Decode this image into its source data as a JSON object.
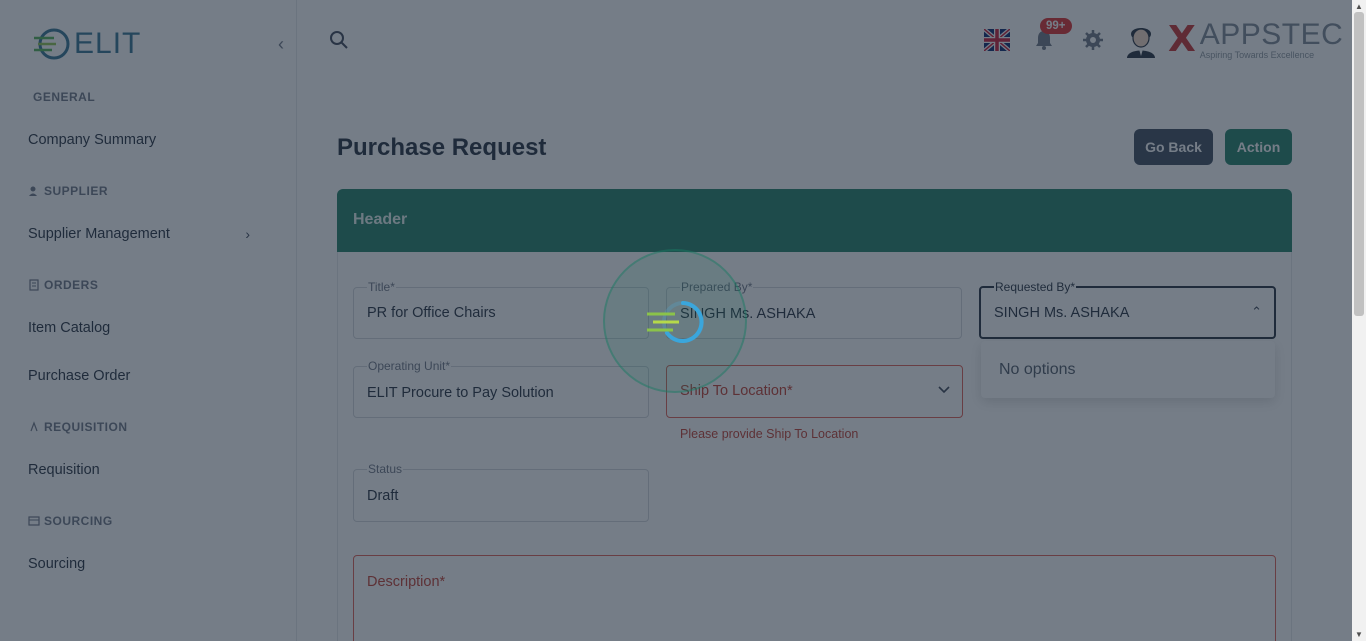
{
  "sidebar": {
    "logo_text": "ELIT",
    "sections": {
      "general": "GENERAL",
      "supplier": "SUPPLIER",
      "orders": "ORDERS",
      "requisition": "REQUISITION",
      "sourcing": "SOURCING"
    },
    "items": {
      "company_summary": "Company Summary",
      "supplier_management": "Supplier Management",
      "item_catalog": "Item Catalog",
      "purchase_order": "Purchase Order",
      "requisition": "Requisition",
      "sourcing": "Sourcing"
    }
  },
  "topbar": {
    "notification_count": "99+",
    "brand_name": "APPSTEC",
    "brand_tagline": "Aspiring Towards Excellence"
  },
  "page": {
    "title": "Purchase Request",
    "go_back_label": "Go Back",
    "action_label": "Action",
    "card_header": "Header"
  },
  "form": {
    "title": {
      "label": "Title*",
      "value": "PR for Office Chairs"
    },
    "prepared_by": {
      "label": "Prepared By*",
      "value": "SINGH Ms. ASHAKA"
    },
    "requested_by": {
      "label": "Requested By*",
      "value": "SINGH Ms. ASHAKA"
    },
    "operating_unit": {
      "label": "Operating Unit*",
      "value": "ELIT Procure to Pay Solution"
    },
    "ship_to_location": {
      "placeholder": "Ship To Location*",
      "error": "Please provide Ship To Location"
    },
    "status": {
      "label": "Status",
      "value": "Draft"
    },
    "description": {
      "placeholder": "Description*"
    },
    "requested_by_dropdown": {
      "empty_text": "No options"
    }
  },
  "colors": {
    "accent": "#1b7b63",
    "dark_button": "#374458",
    "error": "#c0392b",
    "overlay": "#212d3e"
  }
}
